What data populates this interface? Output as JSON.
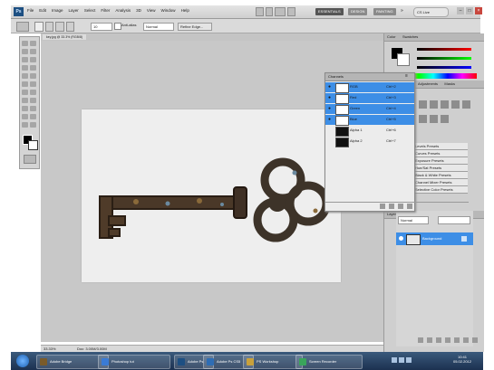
{
  "menubar": {
    "logo": "Ps",
    "menus": [
      "File",
      "Edit",
      "Image",
      "Layer",
      "Select",
      "Filter",
      "Analysis",
      "3D",
      "View",
      "Window",
      "Help"
    ],
    "workspace_buttons": [
      "ESSENTIALS",
      "DESIGN",
      "PAINTING"
    ],
    "search_label": "CS Live"
  },
  "optionsbar": {
    "feather_value": "10",
    "anti_alias_label": "Anti-alias",
    "style_label": "Normal",
    "refine_label": "Refine Edge..."
  },
  "document": {
    "tab_title": "key.jpg @ 33.3% (RGB/8)",
    "zoom": "33.33%",
    "doc_info": "Doc: 3.00M/3.00M"
  },
  "channels": {
    "title": "Channels",
    "rows": [
      {
        "name": "RGB",
        "key": "Ctrl+2",
        "selected": true
      },
      {
        "name": "Red",
        "key": "Ctrl+3",
        "selected": true
      },
      {
        "name": "Green",
        "key": "Ctrl+4",
        "selected": true
      },
      {
        "name": "Blue",
        "key": "Ctrl+5",
        "selected": true
      },
      {
        "name": "Alpha 1",
        "key": "Ctrl+6",
        "selected": false
      },
      {
        "name": "Alpha 2",
        "key": "Ctrl+7",
        "selected": false
      }
    ]
  },
  "right_panels": {
    "color_tabs": [
      "Color",
      "Swatches"
    ],
    "adjust_tabs": [
      "Adjustments",
      "Masks"
    ],
    "style_items": [
      "Levels Presets",
      "Curves Presets",
      "Exposure Presets",
      "Hue/Sat Presets",
      "Black & White Presets",
      "Channel Mixer Presets",
      "Selective Color Presets"
    ],
    "layers_tabs": [
      "Layers",
      "Channels",
      "Paths"
    ],
    "blend_mode": "Normal",
    "layer_name": "Background"
  },
  "taskbar": {
    "tasks": [
      {
        "label": "Adobe Bridge",
        "icon": "bridge-icon",
        "color": "#7a5b2a"
      },
      {
        "label": "Photoshop tut",
        "icon": "browser-icon",
        "color": "#3a7bd5"
      },
      {
        "label": "Adobe Ps",
        "icon": "photoshop-icon",
        "color": "#1d4f82"
      },
      {
        "label": "Adobe Ps CS5",
        "icon": "photoshop-icon",
        "color": "#2e6db4"
      },
      {
        "label": "PS Workshop",
        "icon": "folder-icon",
        "color": "#c9a13b"
      },
      {
        "label": "Screen Recorder",
        "icon": "recorder-icon",
        "color": "#3aa55b"
      }
    ],
    "clock": "10:41",
    "date": "05.02.2012"
  },
  "colors": {
    "accent": "#3d8ee6",
    "ps_blue": "#1d4f82",
    "taskbar": "#2a4566"
  }
}
